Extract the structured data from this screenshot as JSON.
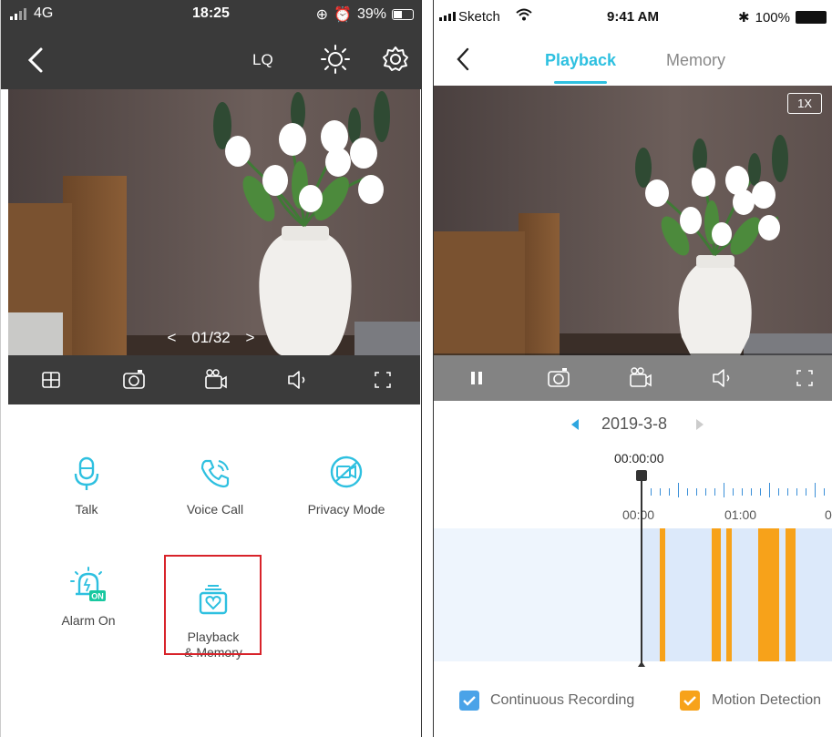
{
  "left_phone": {
    "status": {
      "network": "4G",
      "time": "18:25",
      "battery": "39%"
    },
    "nav": {
      "quality": "LQ"
    },
    "video": {
      "paging": "01/32",
      "prev": "<",
      "next": ">"
    },
    "controls": [
      "grid-icon",
      "camera-icon",
      "video-record-icon",
      "speaker-icon",
      "fullscreen-icon"
    ],
    "functions": [
      {
        "label": "Talk",
        "icon": "microphone-icon"
      },
      {
        "label": "Voice Call",
        "icon": "phone-call-icon"
      },
      {
        "label": "Privacy Mode",
        "icon": "privacy-mode-icon"
      },
      {
        "label": "Alarm On",
        "icon": "alarm-icon",
        "badge": "ON"
      },
      {
        "label": "Playback\n& Memory",
        "icon": "playback-memory-icon"
      }
    ]
  },
  "right_phone": {
    "status": {
      "carrier": "Sketch",
      "time": "9:41 AM",
      "battery": "100%"
    },
    "tabs": {
      "playback": "Playback",
      "memory": "Memory"
    },
    "zoom": "1X",
    "date": "2019-3-8",
    "timeline": {
      "current_time": "00:00:00",
      "labels": [
        "00:00",
        "01:00",
        "0"
      ]
    },
    "legend": {
      "continuous": "Continuous Recording",
      "motion": "Motion Detection"
    },
    "colors": {
      "accent": "#2ec0e0",
      "motion": "#f7a21a",
      "continuous": "#4aa3e8"
    }
  }
}
